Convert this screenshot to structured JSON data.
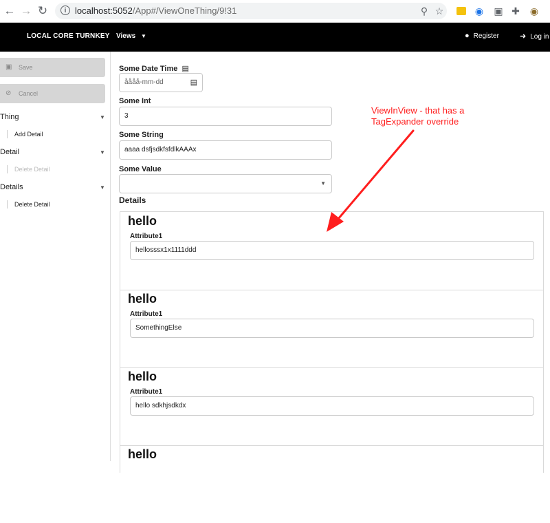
{
  "browser": {
    "url_host": "localhost:5052",
    "url_path": "/App#/ViewOneThing/9!31",
    "info_icon": "i"
  },
  "appbar": {
    "brand": "LOCAL CORE TURNKEY",
    "views_label": "Views",
    "register_label": "Register",
    "login_label": "Log in"
  },
  "sidebar": {
    "save_label": "Save",
    "cancel_label": "Cancel",
    "groups": [
      {
        "label": "Thing",
        "item": "Add Detail"
      },
      {
        "label": "Detail",
        "item": "Delete Detail"
      },
      {
        "label": "Details",
        "item": "Delete Detail"
      }
    ]
  },
  "form": {
    "date_label": "Some Date Time",
    "date_placeholder": "åååå-mm-dd",
    "int_label": "Some Int",
    "int_value": "3",
    "string_label": "Some String",
    "string_value": "aaaa dsfjsdkfsfdlkAAAx",
    "value_label": "Some Value",
    "value_value": "",
    "details_title": "Details"
  },
  "details": [
    {
      "title": "hello",
      "attr_label": "Attribute1",
      "attr_value": "hellosssx1x1111ddd"
    },
    {
      "title": "hello",
      "attr_label": "Attribute1",
      "attr_value": "SomethingElse"
    },
    {
      "title": "hello",
      "attr_label": "Attribute1",
      "attr_value": "hello sdkhjsdkdx"
    },
    {
      "title": "hello",
      "attr_label": "",
      "attr_value": ""
    }
  ],
  "annotation": {
    "line1": "ViewInView - that has a",
    "line2": "TagExpander override",
    "color": "#ff1e1e"
  },
  "colors": {
    "appbar_bg": "#000000",
    "sidebar_button_bg": "#d6d6d6"
  }
}
